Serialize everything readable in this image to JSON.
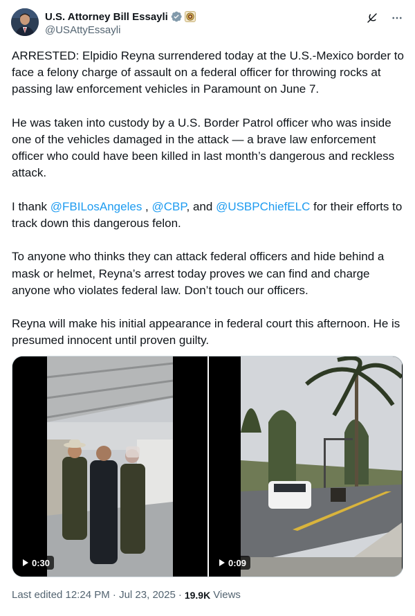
{
  "author": {
    "display_name": "U.S. Attorney Bill Essayli",
    "handle": "@USAttyEssayli",
    "verified_icon": "verified-badge-icon",
    "affiliation_icon": "government-seal-icon"
  },
  "actions": {
    "grok_icon": "grok-icon",
    "more_icon": "more-dots-icon"
  },
  "tweet": {
    "paragraphs": [
      {
        "runs": [
          {
            "text": "ARRESTED: Elpidio Reyna surrendered today at the U.S.-Mexico border to face a felony charge of assault on a federal officer for throwing rocks at passing law enforcement vehicles in Paramount on June 7."
          }
        ]
      },
      {
        "runs": [
          {
            "text": "He was taken into custody by a U.S. Border Patrol officer who was inside one of the vehicles damaged in the attack — a brave law enforcement officer who could have been killed in last month’s dangerous and reckless attack."
          }
        ]
      },
      {
        "runs": [
          {
            "text": "I thank "
          },
          {
            "text": "@FBILosAngeles",
            "mention": true
          },
          {
            "text": " , "
          },
          {
            "text": "@CBP",
            "mention": true
          },
          {
            "text": ", and "
          },
          {
            "text": "@USBPChiefELC",
            "mention": true
          },
          {
            "text": " for their efforts to track down this dangerous felon."
          }
        ]
      },
      {
        "runs": [
          {
            "text": "To anyone who thinks they can attack federal officers and hide behind a mask or helmet, Reyna’s arrest today proves we can find and charge anyone who violates federal law. Don’t touch our officers."
          }
        ]
      },
      {
        "runs": [
          {
            "text": "Reyna will make his initial appearance in federal court this afternoon. He is presumed innocent until proven guilty."
          }
        ]
      }
    ]
  },
  "media": {
    "video1": {
      "duration": "0:30",
      "play_icon": "play-icon"
    },
    "video2": {
      "duration": "0:09",
      "play_icon": "play-icon"
    }
  },
  "footer": {
    "edited": "Last edited 12:24 PM · Jul 23, 2025",
    "separator": "·",
    "views_count": "19.9K",
    "views_label": "Views"
  },
  "colors": {
    "text": "#0f1419",
    "secondary": "#536471",
    "link": "#1d9bf0",
    "border": "#cfd9de"
  }
}
